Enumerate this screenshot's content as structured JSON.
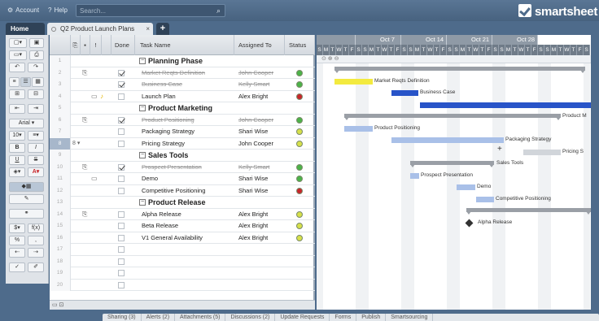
{
  "topbar": {
    "account_label": "Account",
    "help_label": "Help",
    "search_placeholder": "Search...",
    "brand": "smartsheet"
  },
  "tabs": {
    "home_label": "Home",
    "sheet_label": "Q2 Product Launch Plans",
    "close_glyph": "×",
    "add_glyph": "+"
  },
  "toolbar": {
    "font_family": "Arial",
    "font_size": "10",
    "bold": "B",
    "italic": "I",
    "underline": "U",
    "strike": "S",
    "currency": "$",
    "percent": "%",
    "function": "f(x)"
  },
  "columns": {
    "done": "Done",
    "task_name": "Task Name",
    "assigned_to": "Assigned To",
    "status": "Status"
  },
  "rows": [
    {
      "num": "1",
      "task": "Planning Phase",
      "phase": true,
      "collapse": "−"
    },
    {
      "num": "2",
      "task": "Market Reqts Definition",
      "assigned": "John Cooper",
      "done": true,
      "status": "#4cb348",
      "attach": true
    },
    {
      "num": "3",
      "task": "Business Case",
      "assigned": "Kelly Smart",
      "done": true,
      "status": "#4cb348"
    },
    {
      "num": "4",
      "task": "Launch Plan",
      "assigned": "Alex Bright",
      "done": false,
      "status": "#c8262a",
      "comment": true,
      "alert": true
    },
    {
      "num": "5",
      "task": "Product Marketing",
      "phase": true,
      "collapse": "−"
    },
    {
      "num": "6",
      "task": "Product Positioning",
      "assigned": "John Cooper",
      "done": true,
      "status": "#4cb348",
      "attach": true
    },
    {
      "num": "7",
      "task": "Packaging Strategy",
      "assigned": "Shari Wise",
      "done": false,
      "status": "#d6e04a"
    },
    {
      "num": "8",
      "task": "Pricing Strategy",
      "assigned": "John Cooper",
      "done": false,
      "status": "#d6e04a",
      "selected": true
    },
    {
      "num": "9",
      "task": "Sales Tools",
      "phase": true,
      "collapse": "−"
    },
    {
      "num": "10",
      "task": "Prospect Presentation",
      "assigned": "Kelly Smart",
      "done": true,
      "status": "#4cb348",
      "attach": true
    },
    {
      "num": "11",
      "task": "Demo",
      "assigned": "Shari Wise",
      "done": false,
      "status": "#4cb348",
      "comment": true
    },
    {
      "num": "12",
      "task": "Competitive Positioning",
      "assigned": "Shari Wise",
      "done": false,
      "status": "#c8262a"
    },
    {
      "num": "13",
      "task": "Product Release",
      "phase": true,
      "collapse": "−"
    },
    {
      "num": "14",
      "task": "Alpha Release",
      "assigned": "Alex Bright",
      "done": false,
      "status": "#d6e04a",
      "attach": true
    },
    {
      "num": "15",
      "task": "Beta Release",
      "assigned": "Alex Bright",
      "done": false,
      "status": "#d6e04a"
    },
    {
      "num": "16",
      "task": "V1 General Availability",
      "assigned": "Alex Bright",
      "done": false,
      "status": "#d6e04a"
    },
    {
      "num": "17",
      "task": ""
    },
    {
      "num": "18",
      "task": ""
    },
    {
      "num": "19",
      "task": ""
    },
    {
      "num": "20",
      "task": ""
    }
  ],
  "gantt": {
    "weeks": [
      "Oct 7",
      "Oct 14",
      "Oct 21",
      "Oct 28"
    ],
    "days": [
      "S",
      "M",
      "T",
      "W",
      "T",
      "F",
      "S",
      "S",
      "M",
      "T",
      "W",
      "T",
      "F",
      "S",
      "S",
      "M",
      "T",
      "W",
      "T",
      "F",
      "S",
      "S",
      "M",
      "T",
      "W",
      "T",
      "F",
      "S",
      "S",
      "M",
      "T",
      "W",
      "T",
      "F",
      "S",
      "S",
      "M",
      "T",
      "W",
      "T",
      "F",
      "S"
    ],
    "tool_glyphs": "⊙  ⊕  ⊖",
    "bar_labels": {
      "market": "Market Reqts Definition",
      "business": "Business Case",
      "product_marketing": "Product M",
      "positioning": "Product Positioning",
      "packaging": "Packaging Strategy",
      "pricing": "Pricing S",
      "sales_tools": "Sales Tools",
      "prospect": "Prospect Presentation",
      "demo": "Demo",
      "competitive": "Competitive Positioning",
      "alpha": "Alpha Release"
    },
    "colors": {
      "yellow": "#f3ea3f",
      "blue": "#2854c8",
      "lightblue": "#a9c0e8",
      "grey": "#d1d5da",
      "summary": "#9a9fa6"
    }
  },
  "bottom_tabs": [
    "Sharing (3)",
    "Alerts (2)",
    "Attachments (5)",
    "Discussions (2)",
    "Update Requests",
    "Forms",
    "Publish",
    "Smartsourcing"
  ]
}
